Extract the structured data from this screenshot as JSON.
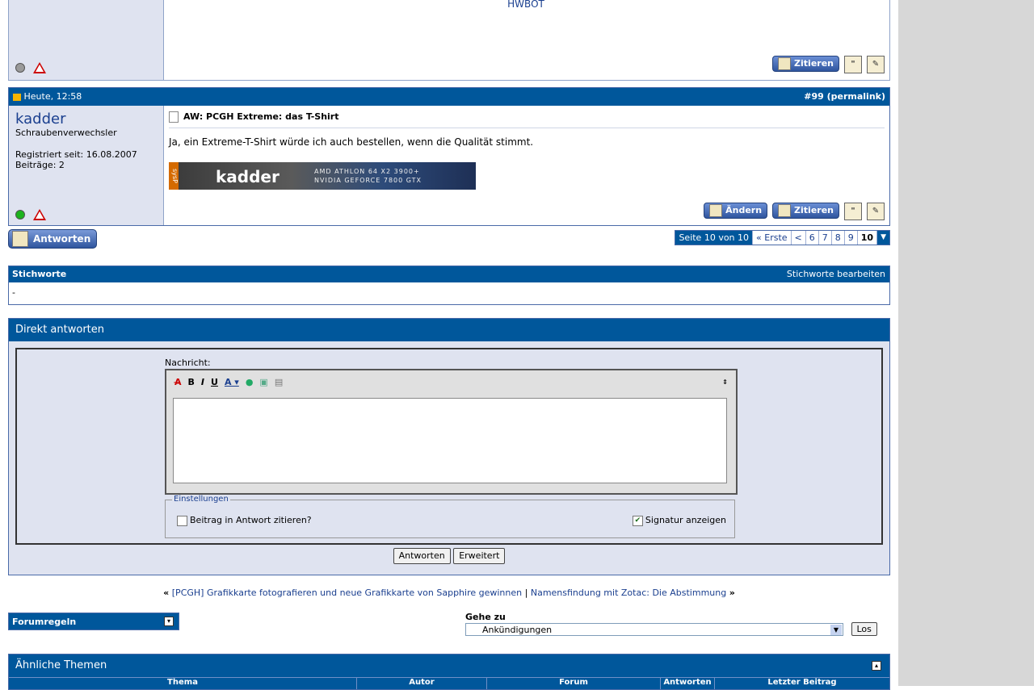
{
  "prev_post": {
    "signature": "HWBOT"
  },
  "post": {
    "date": "Heute, 12:58",
    "number_link": "#99 (permalink)",
    "username": "kadder",
    "user_title": "Schraubenverwechsler",
    "join": "Registriert seit: 16.08.2007",
    "posts": "Beiträge: 2",
    "title": "AW: PCGH Extreme: das T-Shirt",
    "text": "Ja, ein Extreme-T-Shirt würde ich auch bestellen, wenn die Qualität stimmt.",
    "banner_name": "kadder",
    "banner_spec1": "AMD ATHLON 64 X2 3900+",
    "banner_spec2": "NVIDIA GEFORCE 7800 GTX",
    "banner_tag": "sysP",
    "edit_label": "Ändern",
    "quote_label": "Zitieren"
  },
  "prev_actions": {
    "quote_label": "Zitieren"
  },
  "reply_button": "Antworten",
  "pager": {
    "label": "Seite 10 von 10",
    "first": "« Erste",
    "prev": "<",
    "pages": [
      "6",
      "7",
      "8",
      "9"
    ],
    "current": "10"
  },
  "tags": {
    "title": "Stichworte",
    "edit": "Stichworte bearbeiten",
    "value": "-"
  },
  "quick_reply": {
    "title": "Direkt antworten",
    "message_label": "Nachricht:",
    "settings_label": "Einstellungen",
    "quote_option": "Beitrag in Antwort zitieren?",
    "signature_option": "Signatur anzeigen",
    "submit": "Antworten",
    "advanced": "Erweitert"
  },
  "thread_nav": {
    "prev_thread": "[PCGH] Grafikkarte fotografieren und neue Grafikkarte von Sapphire gewinnen",
    "next_thread": "Namensfindung mit Zotac: Die Abstimmung"
  },
  "forum_rules": "Forumregeln",
  "goto": {
    "label": "Gehe zu",
    "selected": "Ankündigungen",
    "button": "Los"
  },
  "similar": {
    "title": "Ähnliche Themen",
    "columns": [
      "Thema",
      "Autor",
      "Forum",
      "Antworten",
      "Letzter Beitrag"
    ]
  }
}
